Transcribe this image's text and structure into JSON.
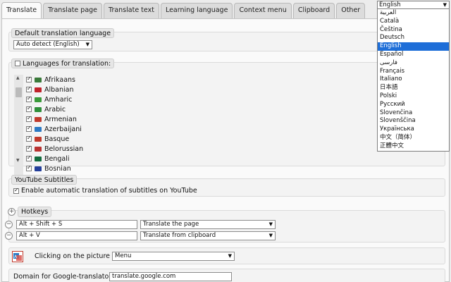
{
  "tabs": [
    "Translate",
    "Translate page",
    "Translate text",
    "Learning language",
    "Context menu",
    "Clipboard",
    "Other"
  ],
  "default_language": {
    "legend": "Default translation language",
    "value": "Auto detect (English)",
    "arrow": "▼"
  },
  "languages_panel": {
    "legend": "Languages for translation:",
    "items": [
      {
        "label": "Afrikaans",
        "flag": "#3a7a3a"
      },
      {
        "label": "Albanian",
        "flag": "#c0222a"
      },
      {
        "label": "Amharic",
        "flag": "#3a9a3a"
      },
      {
        "label": "Arabic",
        "flag": "#2f8f3a"
      },
      {
        "label": "Armenian",
        "flag": "#c0392b"
      },
      {
        "label": "Azerbaijani",
        "flag": "#2b79c4"
      },
      {
        "label": "Basque",
        "flag": "#c0392b"
      },
      {
        "label": "Belorussian",
        "flag": "#b83230"
      },
      {
        "label": "Bengali",
        "flag": "#116b3d"
      },
      {
        "label": "Bosnian",
        "flag": "#233e9a"
      }
    ]
  },
  "youtube": {
    "legend": "YouTube Subtitles",
    "checkbox_label": "Enable automatic translation of subtitles on YouTube"
  },
  "hotkeys": {
    "legend": "Hotkeys",
    "add_icon": "+",
    "remove_icon": "−",
    "rows": [
      {
        "keys": "Alt + Shift + S",
        "action": "Translate the page"
      },
      {
        "keys": "Alt + V",
        "action": "Translate from clipboard"
      }
    ]
  },
  "picture": {
    "label": "Clicking on the picture",
    "value": "Menu"
  },
  "domain": {
    "label": "Domain for Google-translator:",
    "value": "translate.google.com"
  },
  "ui_language": {
    "selected": "English",
    "options": [
      "العربية",
      "Català",
      "Čeština",
      "Deutsch",
      "English",
      "Español",
      "فارسی",
      "Français",
      "Italiano",
      "日本語",
      "Polski",
      "Русский",
      "Slovenčina",
      "Slovenščina",
      "Українська",
      "中文（简体）",
      "正體中文"
    ]
  },
  "icons": {
    "chevron_down": "▼",
    "scroll_up": "▲",
    "scroll_down": "▼"
  }
}
